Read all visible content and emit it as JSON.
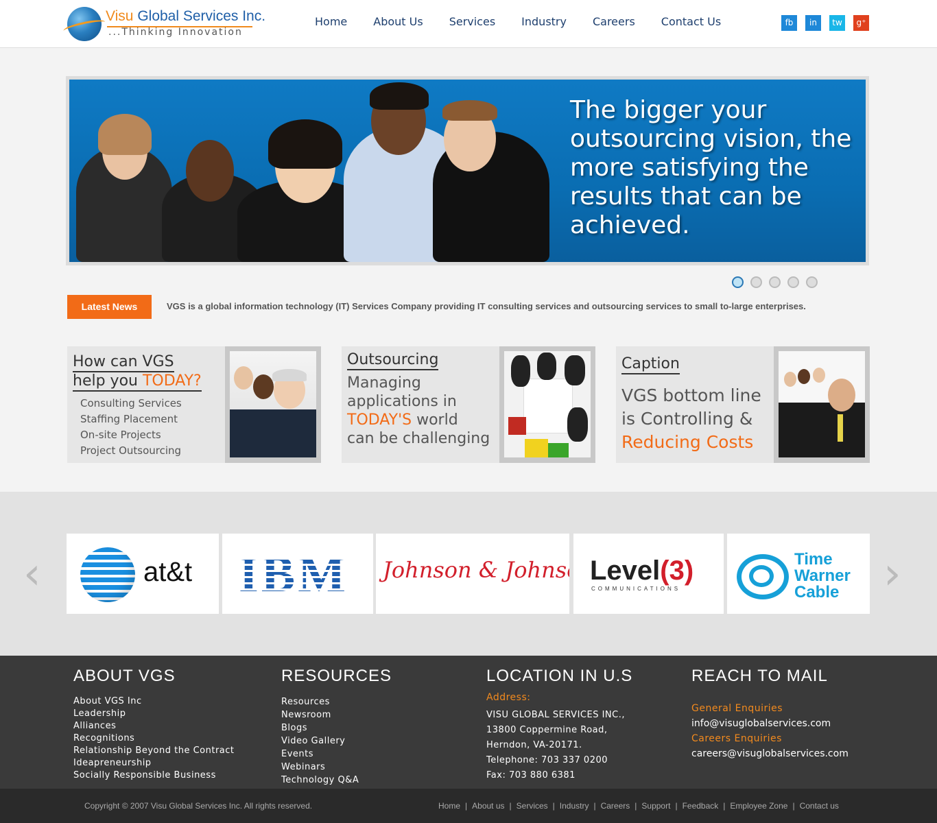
{
  "brand": {
    "name_prefix": "Visu",
    "name_rest": " Global Services Inc.",
    "tagline": "...Thinking Innovation"
  },
  "nav": [
    "Home",
    "About Us",
    "Services",
    "Industry",
    "Careers",
    "Contact Us"
  ],
  "social": [
    {
      "label": "fb",
      "color": "#1e88d8"
    },
    {
      "label": "in",
      "color": "#1e88d8"
    },
    {
      "label": "tw",
      "color": "#19b6e8"
    },
    {
      "label": "g⁺",
      "color": "#e0411e"
    }
  ],
  "hero": {
    "text": "The bigger your outsourcing vision, the more satisfying the results that can be achieved.",
    "slides": 5,
    "active_slide": 1
  },
  "news": {
    "button": "Latest News",
    "text": "VGS is a global information technology (IT) Services Company providing IT consulting services and outsourcing services to small to-large enterprises."
  },
  "cards": {
    "c1": {
      "title_line1": "How can VGS",
      "title_line2_plain": "help you ",
      "title_line2_highlight": "TODAY?",
      "items": [
        "Consulting Services",
        "Staffing Placement",
        "On-site Projects",
        "Project Outsourcing"
      ]
    },
    "c2": {
      "title": "Outsourcing",
      "line1": "Managing",
      "line2": "applications in",
      "line3_highlight": "TODAY'S",
      "line3_rest": " world",
      "line4": "can be challenging"
    },
    "c3": {
      "title": "Caption",
      "line1": "VGS bottom line",
      "line2": "is Controlling &",
      "line3_highlight": "Reducing Costs"
    }
  },
  "clients": {
    "prev": "‹",
    "next": "›",
    "logos": {
      "att": "at&t",
      "ibm": "IBM",
      "jj": "Johnson & Johnson",
      "level3_text": "Level",
      "level3_num": "(3)",
      "level3_sub": "COMMUNICATIONS",
      "twc_line1": "Time",
      "twc_line2": "Warner",
      "twc_line3": "Cable"
    }
  },
  "footer": {
    "about": {
      "heading": "ABOUT VGS",
      "links": [
        "About VGS Inc",
        "Leadership",
        "Alliances",
        "Recognitions",
        "Relationship Beyond the Contract",
        "Ideapreneurship",
        "Socially Responsible Business"
      ]
    },
    "resources": {
      "heading": "RESOURCES",
      "links": [
        "Resources",
        "Newsroom",
        "Blogs",
        "Video Gallery",
        "Events",
        "Webinars",
        "Technology Q&A"
      ]
    },
    "location": {
      "heading": "LOCATION IN U.S",
      "label": "Address:",
      "lines": [
        "VISU GLOBAL SERVICES INC.,",
        "13800 Coppermine Road,",
        "Herndon, VA-20171.",
        "Telephone: 703 337 0200",
        "Fax: 703 880 6381"
      ]
    },
    "mail": {
      "heading": "REACH TO MAIL",
      "general_label": "General Enquiries",
      "general_email": "info@visuglobalservices.com",
      "careers_label": "Careers Enquiries",
      "careers_email": "careers@visuglobalservices.com"
    }
  },
  "bottom": {
    "copyright": "Copyright © 2007 Visu Global Services Inc. All rights reserved.",
    "links": [
      "Home",
      "About us",
      "Services",
      "Industry",
      "Careers",
      "Support",
      "Feedback",
      "Employee Zone",
      "Contact us"
    ],
    "separator": "|"
  }
}
